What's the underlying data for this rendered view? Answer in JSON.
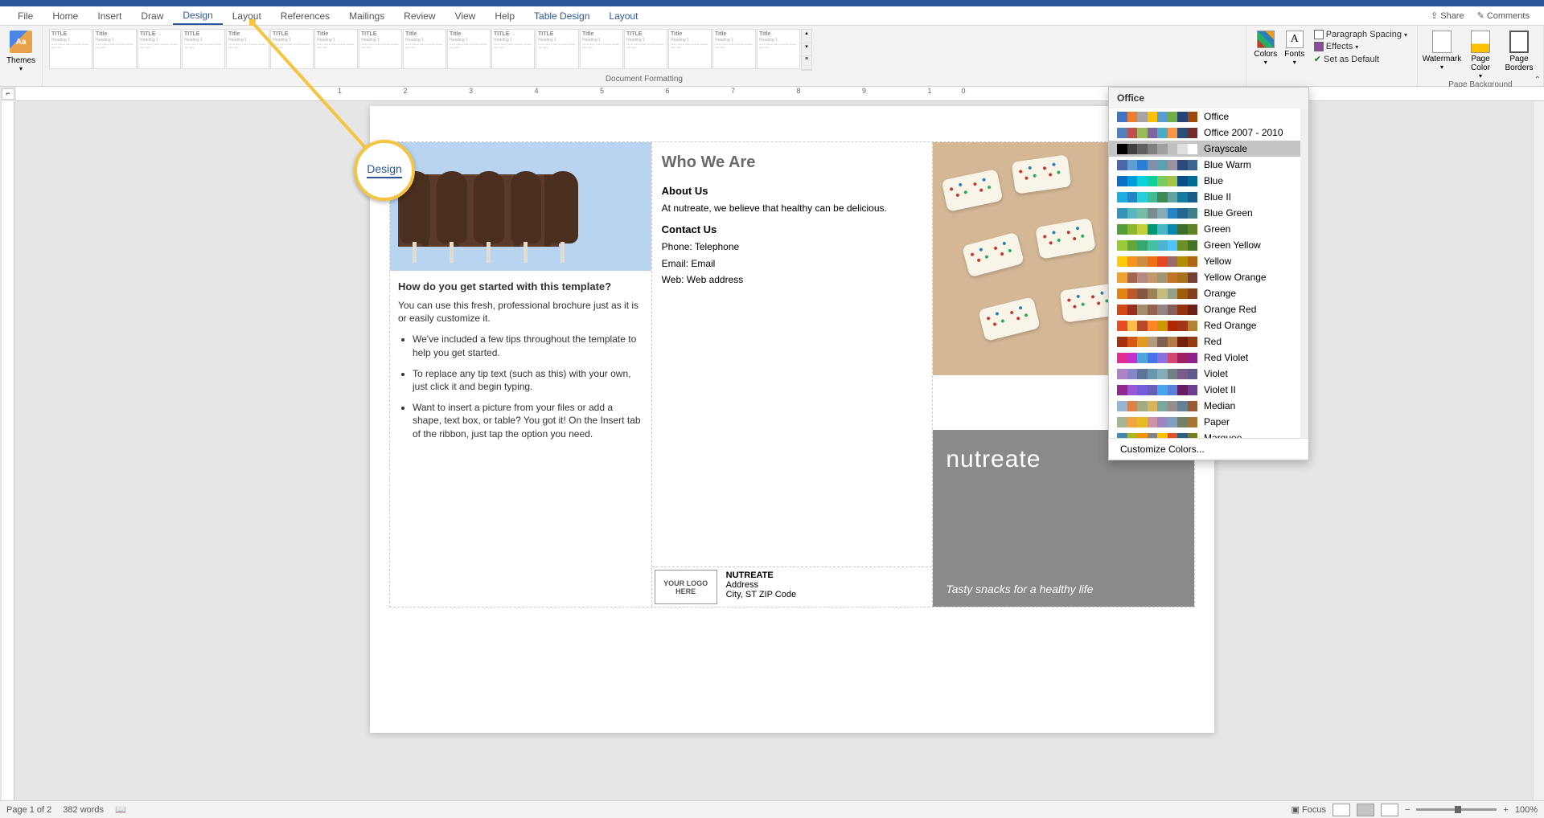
{
  "tabs": {
    "file": "File",
    "home": "Home",
    "insert": "Insert",
    "draw": "Draw",
    "design": "Design",
    "layout": "Layout",
    "references": "References",
    "mailings": "Mailings",
    "review": "Review",
    "view": "View",
    "help": "Help",
    "table_design": "Table Design",
    "table_layout": "Layout"
  },
  "title_buttons": {
    "share": "Share",
    "comments": "Comments"
  },
  "ribbon": {
    "themes": "Themes",
    "doc_formatting": "Document Formatting",
    "colors": "Colors",
    "fonts": "Fonts",
    "para_spacing": "Paragraph Spacing",
    "effects": "Effects",
    "set_default": "Set as Default",
    "watermark": "Watermark",
    "page_color": "Page Color",
    "page_borders": "Page Borders",
    "page_background": "Page Background"
  },
  "gallery_titles": [
    "TITLE",
    "Title",
    "TITLE",
    "TITLE",
    "Title",
    "TITLE",
    "Title",
    "TITLE",
    "Title",
    "Title",
    "TITLE",
    "TITLE",
    "Title",
    "TITLE",
    "Title",
    "Title",
    "Title"
  ],
  "callout": "Design",
  "document": {
    "panel1": {
      "h": "How do you get started with this template?",
      "p": "You can use this fresh, professional brochure just as it is or easily customize it.",
      "li1": "We've included a few tips throughout the template to help you get started.",
      "li2": "To replace any tip text (such as this) with your own, just click it and begin typing.",
      "li3": "Want to insert a picture from your files or add a shape, text box, or table? You got it! On the Insert tab of the ribbon, just tap the option you need."
    },
    "panel2": {
      "h": "Who We Are",
      "about_h": "About Us",
      "about_p": "At nutreate, we believe that healthy can be delicious.",
      "contact_h": "Contact Us",
      "phone": "Phone: Telephone",
      "email": "Email: Email",
      "web": "Web: Web address",
      "logo": "YOUR LOGO HERE",
      "company": "NUTREATE",
      "addr1": "Address",
      "addr2": "City, ST ZIP Code"
    },
    "panel3": {
      "brand": "nutreate",
      "tagline": "Tasty snacks for a healthy life"
    }
  },
  "colors_menu": {
    "header": "Office",
    "items": [
      {
        "name": "Office",
        "c": [
          "#4472c4",
          "#ed7d31",
          "#a5a5a5",
          "#ffc000",
          "#5b9bd5",
          "#70ad47",
          "#264478",
          "#9e480e"
        ]
      },
      {
        "name": "Office 2007 - 2010",
        "c": [
          "#4f81bd",
          "#c0504d",
          "#9bbb59",
          "#8064a2",
          "#4bacc6",
          "#f79646",
          "#2c4d75",
          "#772c2a"
        ]
      },
      {
        "name": "Grayscale",
        "c": [
          "#000000",
          "#404040",
          "#606060",
          "#808080",
          "#a0a0a0",
          "#c0c0c0",
          "#e0e0e0",
          "#ffffff"
        ]
      },
      {
        "name": "Blue Warm",
        "c": [
          "#4a66ac",
          "#629dd1",
          "#297fd5",
          "#7f8fa9",
          "#5aa2ae",
          "#9d90a0",
          "#2e4a7d",
          "#3b6694"
        ]
      },
      {
        "name": "Blue",
        "c": [
          "#0f6fc6",
          "#009dd9",
          "#0bd0d9",
          "#10cf9b",
          "#7cca62",
          "#a5c249",
          "#0a4e8a",
          "#006d97"
        ]
      },
      {
        "name": "Blue II",
        "c": [
          "#1cade4",
          "#2683c6",
          "#27ced7",
          "#42ba97",
          "#3e8853",
          "#62a39f",
          "#147ca0",
          "#1a5b8a"
        ]
      },
      {
        "name": "Blue Green",
        "c": [
          "#3494ba",
          "#58b6c0",
          "#75bda7",
          "#7a8c8e",
          "#84acb6",
          "#2683c6",
          "#24678e",
          "#3d7f86"
        ]
      },
      {
        "name": "Green",
        "c": [
          "#549e39",
          "#8ab833",
          "#c0cf3a",
          "#029676",
          "#4ab5c4",
          "#0989b1",
          "#3b6e28",
          "#608024"
        ]
      },
      {
        "name": "Green Yellow",
        "c": [
          "#99cb38",
          "#63a537",
          "#37a76f",
          "#44c1a3",
          "#4eb3cf",
          "#51c3f9",
          "#6b8e27",
          "#457326"
        ]
      },
      {
        "name": "Yellow",
        "c": [
          "#ffca08",
          "#f8931d",
          "#ce8d3e",
          "#ec7016",
          "#e64823",
          "#9c6a6a",
          "#b28d06",
          "#ae6614"
        ]
      },
      {
        "name": "Yellow Orange",
        "c": [
          "#f0a22e",
          "#a5644e",
          "#b58b80",
          "#c3986d",
          "#a19574",
          "#c17529",
          "#a87120",
          "#733f36"
        ]
      },
      {
        "name": "Orange",
        "c": [
          "#e48312",
          "#bd582c",
          "#865640",
          "#9b8357",
          "#c2bc80",
          "#94a088",
          "#a05c0d",
          "#843d1e"
        ]
      },
      {
        "name": "Orange Red",
        "c": [
          "#d34817",
          "#9b2d1f",
          "#a28e6a",
          "#956251",
          "#918485",
          "#855d5d",
          "#933211",
          "#6c1f15"
        ]
      },
      {
        "name": "Red Orange",
        "c": [
          "#e84c22",
          "#ffbd47",
          "#b64926",
          "#ff8427",
          "#cc9900",
          "#b22600",
          "#a23518",
          "#b28431"
        ]
      },
      {
        "name": "Red",
        "c": [
          "#a5300f",
          "#d55816",
          "#e19825",
          "#b19c7d",
          "#7f5f52",
          "#b27d49",
          "#73210a",
          "#953d0f"
        ]
      },
      {
        "name": "Red Violet",
        "c": [
          "#e32d91",
          "#c830cc",
          "#4ea6dc",
          "#4775e7",
          "#8971e1",
          "#d54773",
          "#9f1f65",
          "#8c218e"
        ]
      },
      {
        "name": "Violet",
        "c": [
          "#ad84c6",
          "#8784c7",
          "#5d739a",
          "#6997af",
          "#84acb6",
          "#6f8183",
          "#795c8a",
          "#5e5c8b"
        ]
      },
      {
        "name": "Violet II",
        "c": [
          "#92278f",
          "#9b57d3",
          "#755dd9",
          "#665eb8",
          "#45a5ed",
          "#5982db",
          "#661b64",
          "#6c3d93"
        ]
      },
      {
        "name": "Median",
        "c": [
          "#94b6d2",
          "#dd8047",
          "#a5ab81",
          "#d8b25c",
          "#7ba79d",
          "#968c8c",
          "#678093",
          "#9a5932"
        ]
      },
      {
        "name": "Paper",
        "c": [
          "#a5b592",
          "#f3a447",
          "#e7bc29",
          "#d092a7",
          "#9c85c0",
          "#809ec2",
          "#738066",
          "#aa7332"
        ]
      },
      {
        "name": "Marquee",
        "c": [
          "#418ab3",
          "#a6b727",
          "#f69200",
          "#838383",
          "#fec306",
          "#df5327",
          "#2d617d",
          "#74801b"
        ]
      }
    ],
    "highlighted": 2,
    "customize": "Customize Colors..."
  },
  "status": {
    "page": "Page 1 of 2",
    "words": "382 words",
    "focus": "Focus",
    "zoom": "100%"
  }
}
